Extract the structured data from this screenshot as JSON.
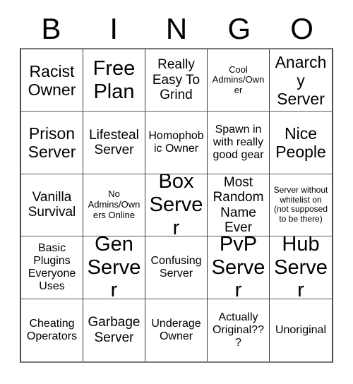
{
  "card": {
    "title": "BINGO",
    "header_letters": [
      "B",
      "I",
      "N",
      "G",
      "O"
    ],
    "rows": 5,
    "columns": 5,
    "colors": {
      "background": "#ffffff",
      "text": "#000000",
      "grid_line": "#3a3a3a",
      "grid_border": "#7a7a7a"
    },
    "cells": [
      {
        "text": "Racist Owner",
        "size": "lg"
      },
      {
        "text": "Free Plan",
        "size": "xl"
      },
      {
        "text": "Really Easy To Grind",
        "size": "md"
      },
      {
        "text": "Cool Admins/Owner",
        "size": "xs"
      },
      {
        "text": "Anarchy Server",
        "size": "lg"
      },
      {
        "text": "Prison Server",
        "size": "lg"
      },
      {
        "text": "Lifesteal Server",
        "size": "md"
      },
      {
        "text": "Homophobic Owner",
        "size": "sm"
      },
      {
        "text": "Spawn in with really good gear",
        "size": "sm"
      },
      {
        "text": "Nice People",
        "size": "lg"
      },
      {
        "text": "Vanilla Survival",
        "size": "md"
      },
      {
        "text": "No Admins/Owners Online",
        "size": "xs"
      },
      {
        "text": "Box Server",
        "size": "xl"
      },
      {
        "text": "Most Random Name Ever",
        "size": "md"
      },
      {
        "text": "Server without whitelist on (not supposed to be there)",
        "size": "xxs"
      },
      {
        "text": "Basic Plugins Everyone Uses",
        "size": "sm"
      },
      {
        "text": "Gen Server",
        "size": "xl"
      },
      {
        "text": "Confusing Server",
        "size": "sm"
      },
      {
        "text": "PvP Server",
        "size": "xl"
      },
      {
        "text": "Hub Server",
        "size": "xl"
      },
      {
        "text": "Cheating Operators",
        "size": "sm"
      },
      {
        "text": "Garbage Server",
        "size": "md"
      },
      {
        "text": "Underage Owner",
        "size": "sm"
      },
      {
        "text": "Actually Original???",
        "size": "sm"
      },
      {
        "text": "Unoriginal",
        "size": "sm"
      }
    ]
  }
}
